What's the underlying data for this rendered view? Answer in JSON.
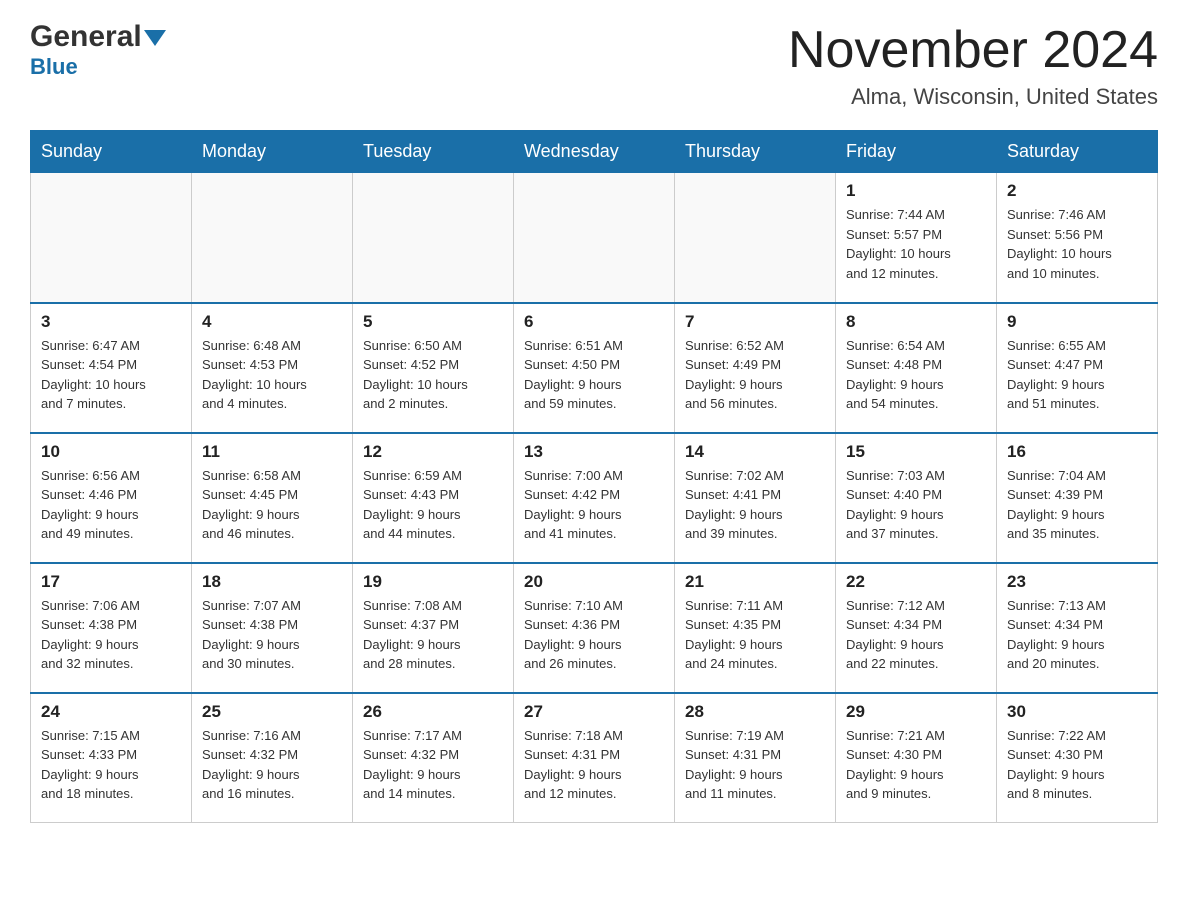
{
  "header": {
    "logo_general": "General",
    "logo_blue": "Blue",
    "month": "November 2024",
    "location": "Alma, Wisconsin, United States"
  },
  "days_of_week": [
    "Sunday",
    "Monday",
    "Tuesday",
    "Wednesday",
    "Thursday",
    "Friday",
    "Saturday"
  ],
  "weeks": [
    [
      {
        "day": "",
        "info": ""
      },
      {
        "day": "",
        "info": ""
      },
      {
        "day": "",
        "info": ""
      },
      {
        "day": "",
        "info": ""
      },
      {
        "day": "",
        "info": ""
      },
      {
        "day": "1",
        "info": "Sunrise: 7:44 AM\nSunset: 5:57 PM\nDaylight: 10 hours\nand 12 minutes."
      },
      {
        "day": "2",
        "info": "Sunrise: 7:46 AM\nSunset: 5:56 PM\nDaylight: 10 hours\nand 10 minutes."
      }
    ],
    [
      {
        "day": "3",
        "info": "Sunrise: 6:47 AM\nSunset: 4:54 PM\nDaylight: 10 hours\nand 7 minutes."
      },
      {
        "day": "4",
        "info": "Sunrise: 6:48 AM\nSunset: 4:53 PM\nDaylight: 10 hours\nand 4 minutes."
      },
      {
        "day": "5",
        "info": "Sunrise: 6:50 AM\nSunset: 4:52 PM\nDaylight: 10 hours\nand 2 minutes."
      },
      {
        "day": "6",
        "info": "Sunrise: 6:51 AM\nSunset: 4:50 PM\nDaylight: 9 hours\nand 59 minutes."
      },
      {
        "day": "7",
        "info": "Sunrise: 6:52 AM\nSunset: 4:49 PM\nDaylight: 9 hours\nand 56 minutes."
      },
      {
        "day": "8",
        "info": "Sunrise: 6:54 AM\nSunset: 4:48 PM\nDaylight: 9 hours\nand 54 minutes."
      },
      {
        "day": "9",
        "info": "Sunrise: 6:55 AM\nSunset: 4:47 PM\nDaylight: 9 hours\nand 51 minutes."
      }
    ],
    [
      {
        "day": "10",
        "info": "Sunrise: 6:56 AM\nSunset: 4:46 PM\nDaylight: 9 hours\nand 49 minutes."
      },
      {
        "day": "11",
        "info": "Sunrise: 6:58 AM\nSunset: 4:45 PM\nDaylight: 9 hours\nand 46 minutes."
      },
      {
        "day": "12",
        "info": "Sunrise: 6:59 AM\nSunset: 4:43 PM\nDaylight: 9 hours\nand 44 minutes."
      },
      {
        "day": "13",
        "info": "Sunrise: 7:00 AM\nSunset: 4:42 PM\nDaylight: 9 hours\nand 41 minutes."
      },
      {
        "day": "14",
        "info": "Sunrise: 7:02 AM\nSunset: 4:41 PM\nDaylight: 9 hours\nand 39 minutes."
      },
      {
        "day": "15",
        "info": "Sunrise: 7:03 AM\nSunset: 4:40 PM\nDaylight: 9 hours\nand 37 minutes."
      },
      {
        "day": "16",
        "info": "Sunrise: 7:04 AM\nSunset: 4:39 PM\nDaylight: 9 hours\nand 35 minutes."
      }
    ],
    [
      {
        "day": "17",
        "info": "Sunrise: 7:06 AM\nSunset: 4:38 PM\nDaylight: 9 hours\nand 32 minutes."
      },
      {
        "day": "18",
        "info": "Sunrise: 7:07 AM\nSunset: 4:38 PM\nDaylight: 9 hours\nand 30 minutes."
      },
      {
        "day": "19",
        "info": "Sunrise: 7:08 AM\nSunset: 4:37 PM\nDaylight: 9 hours\nand 28 minutes."
      },
      {
        "day": "20",
        "info": "Sunrise: 7:10 AM\nSunset: 4:36 PM\nDaylight: 9 hours\nand 26 minutes."
      },
      {
        "day": "21",
        "info": "Sunrise: 7:11 AM\nSunset: 4:35 PM\nDaylight: 9 hours\nand 24 minutes."
      },
      {
        "day": "22",
        "info": "Sunrise: 7:12 AM\nSunset: 4:34 PM\nDaylight: 9 hours\nand 22 minutes."
      },
      {
        "day": "23",
        "info": "Sunrise: 7:13 AM\nSunset: 4:34 PM\nDaylight: 9 hours\nand 20 minutes."
      }
    ],
    [
      {
        "day": "24",
        "info": "Sunrise: 7:15 AM\nSunset: 4:33 PM\nDaylight: 9 hours\nand 18 minutes."
      },
      {
        "day": "25",
        "info": "Sunrise: 7:16 AM\nSunset: 4:32 PM\nDaylight: 9 hours\nand 16 minutes."
      },
      {
        "day": "26",
        "info": "Sunrise: 7:17 AM\nSunset: 4:32 PM\nDaylight: 9 hours\nand 14 minutes."
      },
      {
        "day": "27",
        "info": "Sunrise: 7:18 AM\nSunset: 4:31 PM\nDaylight: 9 hours\nand 12 minutes."
      },
      {
        "day": "28",
        "info": "Sunrise: 7:19 AM\nSunset: 4:31 PM\nDaylight: 9 hours\nand 11 minutes."
      },
      {
        "day": "29",
        "info": "Sunrise: 7:21 AM\nSunset: 4:30 PM\nDaylight: 9 hours\nand 9 minutes."
      },
      {
        "day": "30",
        "info": "Sunrise: 7:22 AM\nSunset: 4:30 PM\nDaylight: 9 hours\nand 8 minutes."
      }
    ]
  ]
}
